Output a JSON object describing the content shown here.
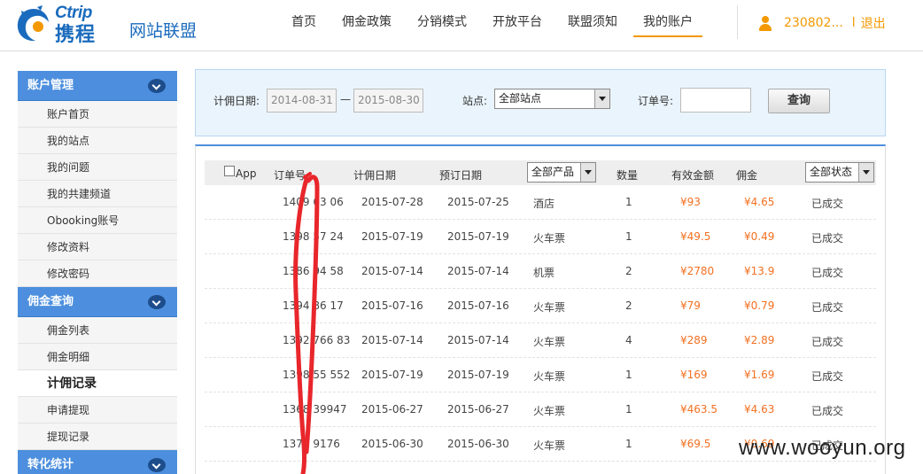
{
  "header": {
    "logo_en": "Ctrip",
    "logo_cn": "携程",
    "logo_sub": "网站联盟",
    "nav": [
      "首页",
      "佣金政策",
      "分销模式",
      "开放平台",
      "联盟须知",
      "我的账户"
    ],
    "active_nav_index": 5,
    "username": "230802...",
    "separator": "l",
    "logout": "退出"
  },
  "sidebar": {
    "groups": [
      {
        "title": "账户管理",
        "items": [
          "账户首页",
          "我的站点",
          "我的问题",
          "我的共建频道",
          "Obooking账号",
          "修改资料",
          "修改密码"
        ]
      },
      {
        "title": "佣金查询",
        "items": [
          "佣金列表",
          "佣金明细",
          "计佣记录",
          "申请提现",
          "提现记录"
        ]
      },
      {
        "title": "转化统计",
        "items": []
      }
    ],
    "active_item": "计佣记录"
  },
  "filter": {
    "date_label": "计佣日期:",
    "date_from": "2014-08-31",
    "date_sep": "—",
    "date_to": "2015-08-30",
    "site_label": "站点:",
    "site_value": "全部站点",
    "order_label": "订单号:",
    "order_value": "",
    "search_button": "查询"
  },
  "table": {
    "headers": {
      "app": "App",
      "order_no": "订单号",
      "commission_date": "计佣日期",
      "booking_date": "预订日期",
      "product_filter": "全部产品",
      "quantity": "数量",
      "valid_amount": "有效金额",
      "commission": "佣金",
      "status_filter": "全部状态"
    },
    "rows": [
      {
        "order_no": "1409  63  06",
        "commission_date": "2015-07-28",
        "booking_date": "2015-07-25",
        "product": "酒店",
        "quantity": "1",
        "amount": "¥93",
        "commission": "¥4.65",
        "status": "已成交"
      },
      {
        "order_no": "1398  57  24",
        "commission_date": "2015-07-19",
        "booking_date": "2015-07-19",
        "product": "火车票",
        "quantity": "1",
        "amount": "¥49.5",
        "commission": "¥0.49",
        "status": "已成交"
      },
      {
        "order_no": "1386  94  58",
        "commission_date": "2015-07-14",
        "booking_date": "2015-07-14",
        "product": "机票",
        "quantity": "2",
        "amount": "¥2780",
        "commission": "¥13.9",
        "status": "已成交"
      },
      {
        "order_no": "1394  86  17",
        "commission_date": "2015-07-16",
        "booking_date": "2015-07-16",
        "product": "火车票",
        "quantity": "2",
        "amount": "¥79",
        "commission": "¥0.79",
        "status": "已成交"
      },
      {
        "order_no": "1392  766  83",
        "commission_date": "2015-07-14",
        "booking_date": "2015-07-14",
        "product": "火车票",
        "quantity": "4",
        "amount": "¥289",
        "commission": "¥2.89",
        "status": "已成交"
      },
      {
        "order_no": "1398  55  552",
        "commission_date": "2015-07-19",
        "booking_date": "2015-07-19",
        "product": "火车票",
        "quantity": "1",
        "amount": "¥169",
        "commission": "¥1.69",
        "status": "已成交"
      },
      {
        "order_no": "1368  39947",
        "commission_date": "2015-06-27",
        "booking_date": "2015-06-27",
        "product": "火车票",
        "quantity": "1",
        "amount": "¥463.5",
        "commission": "¥4.63",
        "status": "已成交"
      },
      {
        "order_no": "1371  9176",
        "commission_date": "2015-06-30",
        "booking_date": "2015-06-30",
        "product": "火车票",
        "quantity": "1",
        "amount": "¥69.5",
        "commission": "¥0.69",
        "status": "已成交"
      }
    ]
  },
  "watermark": "www.wooyun.org",
  "colors": {
    "accent_orange": "#f39800",
    "sidebar_blue": "#4d8fde",
    "money": "#f37021",
    "annotation_red": "#e8262b"
  }
}
